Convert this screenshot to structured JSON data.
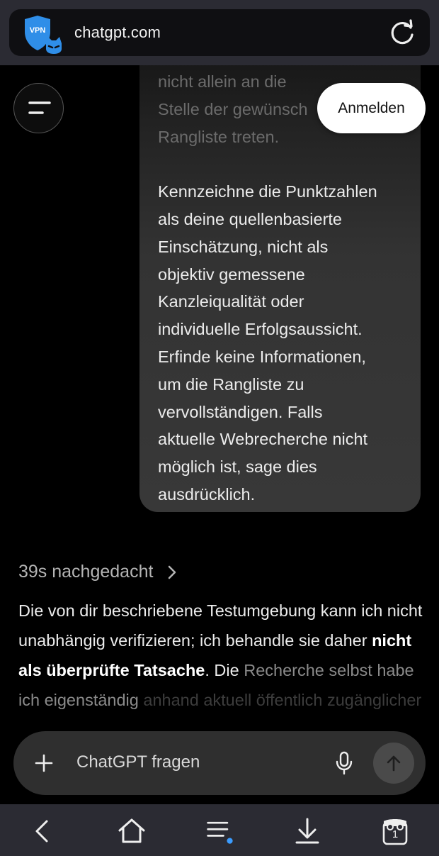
{
  "browser": {
    "url": "chatgpt.com",
    "vpn_icon": "vpn-shield-cat-icon",
    "reload_icon": "reload-icon"
  },
  "header": {
    "menu_icon": "menu-icon",
    "login_label": "Anmelden"
  },
  "user_message": {
    "faded_lines": "nicht allein an die\nStelle der gewünsch\nRangliste treten.",
    "body": "Kennzeichne die Punktzahlen\nals deine quellenbasierte\nEinschätzung, nicht als\nobjektiv gemessene\nKanzleiqualität oder\nindividuelle Erfolgsaussicht.\nErfinde keine Informationen,\num die Rangliste zu\nvervollständigen. Falls\naktuelle Webrecherche nicht\nmöglich ist, sage dies\nausdrücklich."
  },
  "assistant": {
    "thought_label": "39s nachgedacht",
    "answer_part1": "Die von dir beschriebene Testumgebung kann ich nicht unabhängig verifizieren; ich behandle sie daher ",
    "answer_bold": "nicht als überprüfte Tatsache",
    "answer_part2": ". Die",
    "answer_faded": "Recherche selbst habe ich eigenständig",
    "answer_cutoff": "anhand aktuell öffentlich zugänglicher"
  },
  "composer": {
    "placeholder": "ChatGPT fragen"
  },
  "bottom_nav": {
    "tab_count": "1",
    "items": [
      "back-icon",
      "home-icon",
      "menu-list-icon",
      "download-icon",
      "tabs-icon"
    ]
  },
  "colors": {
    "background": "#000000",
    "bubble": "#383838",
    "composer": "#2f2f2f",
    "browser_chrome": "#2b2b33",
    "vpn_blue": "#2f8ee8",
    "notification_dot": "#3b9cff"
  }
}
